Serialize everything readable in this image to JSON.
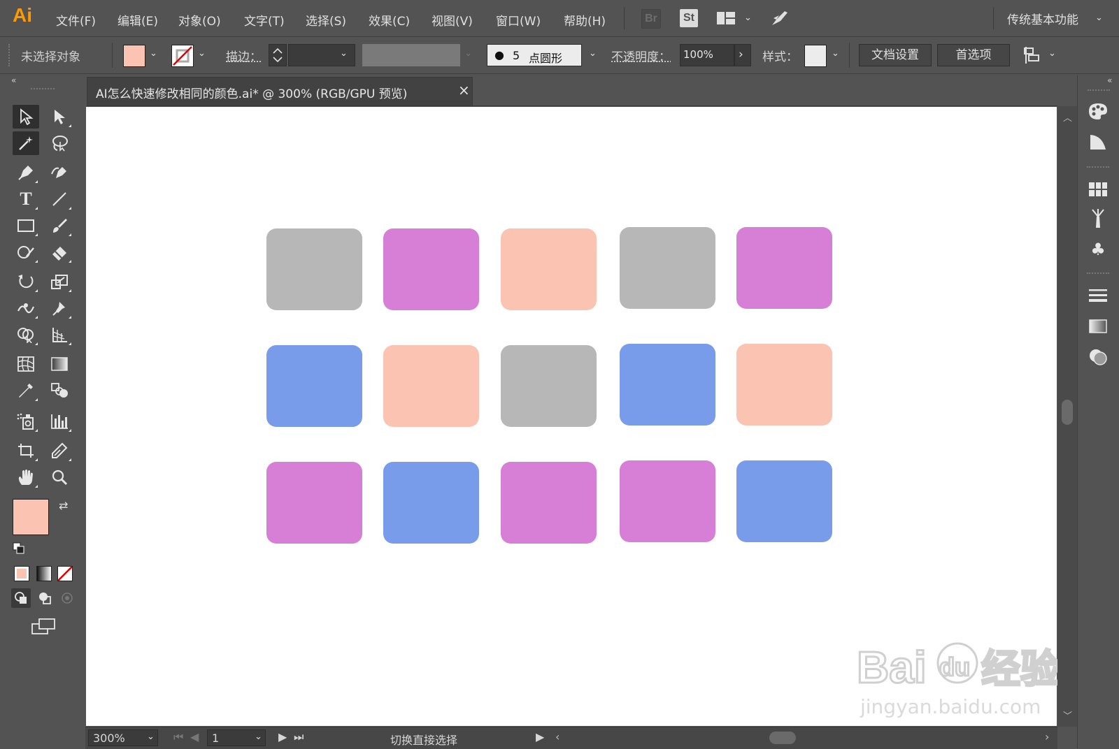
{
  "app": {
    "logo": "Ai",
    "menu": [
      "文件(F)",
      "编辑(E)",
      "对象(O)",
      "文字(T)",
      "选择(S)",
      "效果(C)",
      "视图(V)",
      "窗口(W)",
      "帮助(H)"
    ],
    "badges": {
      "bridge": "Br",
      "stock": "St"
    },
    "workspace": "传统基本功能"
  },
  "control_bar": {
    "selection_label": "未选择对象",
    "fill_color": "#fbc3b2",
    "stroke_label": "描边：",
    "brush_value": "5",
    "brush_label": "点圆形",
    "opacity_label": "不透明度：",
    "opacity_value": "100%",
    "style_label": "样式：",
    "doc_setup_button": "文档设置",
    "preferences_button": "首选项"
  },
  "document": {
    "tab_title": "AI怎么快速修改相同的颜色.ai* @ 300% (RGB/GPU 预览)",
    "close_glyph": "×"
  },
  "colors": {
    "gray": "#b7b7b7",
    "purple": "#d77fd6",
    "peach": "#fbc3b2",
    "blue": "#789ce9"
  },
  "artboard_grid": [
    [
      "gray",
      "purple",
      "peach",
      "gray",
      "purple"
    ],
    [
      "blue",
      "peach",
      "gray",
      "blue",
      "peach"
    ],
    [
      "purple",
      "blue",
      "purple",
      "purple",
      "blue"
    ]
  ],
  "toolbox": {
    "fill_color": "#fbc3b2"
  },
  "status_bar": {
    "zoom": "300%",
    "artboard_number": "1",
    "hint": "切换直接选择"
  },
  "watermark": {
    "brand": "Bai du 经验",
    "url": "jingyan.baidu.com"
  }
}
